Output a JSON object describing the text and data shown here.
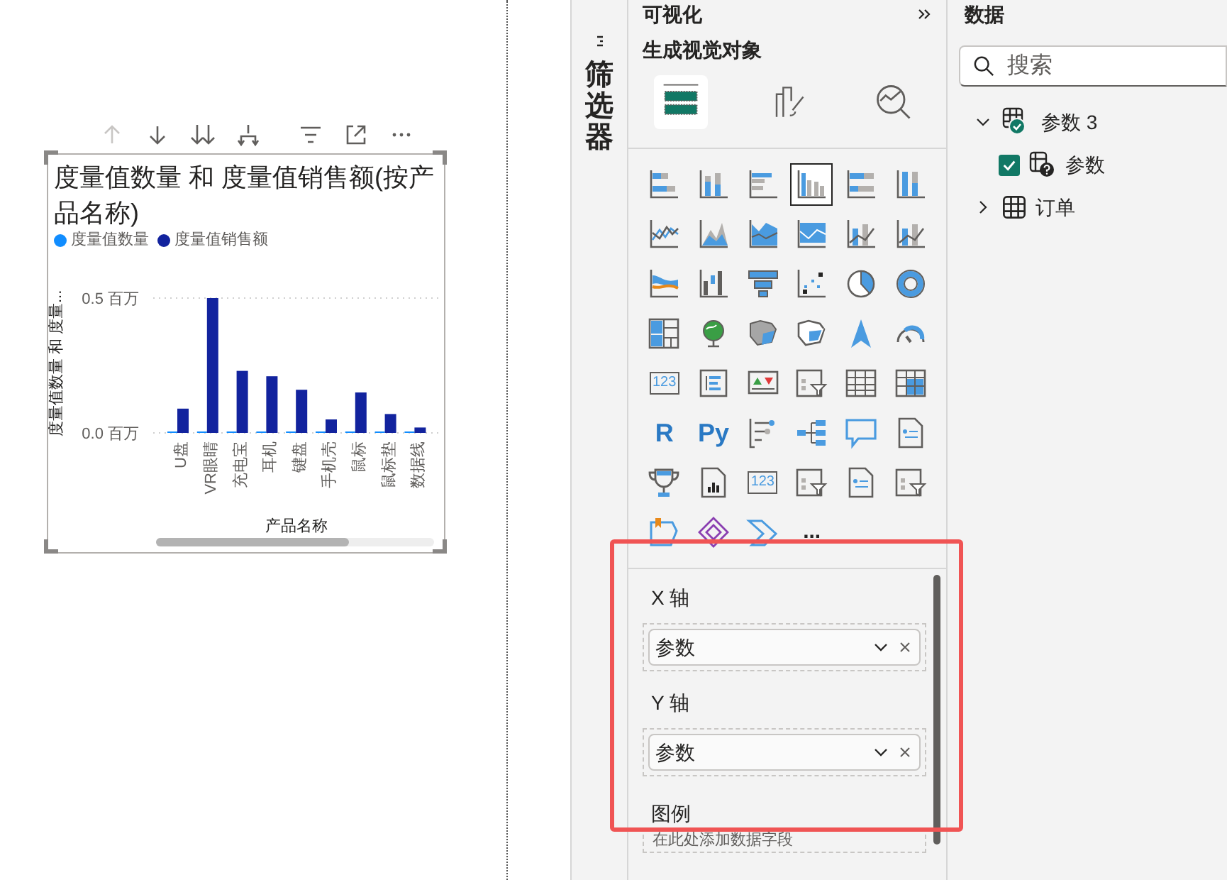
{
  "visual": {
    "title": "度量值数量 和 度量值销售额(按产品名称)",
    "chart_data": {
      "type": "bar",
      "xlabel": "产品名称",
      "ylabel": "度量值数量 和 度量...",
      "categories": [
        "U盘",
        "VR眼睛",
        "充电宝",
        "耳机",
        "键盘",
        "手机壳",
        "鼠标",
        "鼠标垫",
        "数据线"
      ],
      "series": [
        {
          "name": "度量值数量",
          "color": "#118dff",
          "values": [
            0,
            0,
            0,
            0,
            0,
            0,
            0,
            0,
            0
          ]
        },
        {
          "name": "度量值销售额",
          "color": "#12239e",
          "values": [
            0.09,
            0.5,
            0.23,
            0.21,
            0.16,
            0.05,
            0.15,
            0.07,
            0.02
          ]
        }
      ],
      "ylim": [
        0,
        0.5
      ],
      "yticks": [
        {
          "value": 0,
          "label": "0.0 百万"
        },
        {
          "value": 0.5,
          "label": "0.5 百万"
        }
      ]
    }
  },
  "filters_tab": {
    "label": "筛选器"
  },
  "visualizations": {
    "title": "可视化",
    "section": "生成视觉对象",
    "modes": [
      {
        "kind": "build",
        "selected": true
      },
      {
        "kind": "format",
        "selected": false
      },
      {
        "kind": "analytics",
        "selected": false
      }
    ],
    "gallery": [
      {
        "kind": "stacked_bar",
        "selected": false
      },
      {
        "kind": "stacked_column",
        "selected": false
      },
      {
        "kind": "clustered_bar",
        "selected": false
      },
      {
        "kind": "clustered_column",
        "selected": true
      },
      {
        "kind": "full_bar",
        "selected": false
      },
      {
        "kind": "full_column",
        "selected": false
      },
      {
        "kind": "line",
        "selected": false
      },
      {
        "kind": "area",
        "selected": false
      },
      {
        "kind": "stacked_area",
        "selected": false
      },
      {
        "kind": "area_band",
        "selected": false
      },
      {
        "kind": "line_column",
        "selected": false
      },
      {
        "kind": "line_column",
        "selected": false
      },
      {
        "kind": "ribbon",
        "selected": false
      },
      {
        "kind": "waterfall",
        "selected": false
      },
      {
        "kind": "funnel",
        "selected": false
      },
      {
        "kind": "scatter",
        "selected": false
      },
      {
        "kind": "pie",
        "selected": false
      },
      {
        "kind": "donut",
        "selected": false
      },
      {
        "kind": "treemap",
        "selected": false
      },
      {
        "kind": "globe",
        "selected": false
      },
      {
        "kind": "filled_map",
        "selected": false
      },
      {
        "kind": "shape_map",
        "selected": false
      },
      {
        "kind": "arrow",
        "selected": false
      },
      {
        "kind": "gauge",
        "selected": false
      },
      {
        "kind": "card",
        "label": "123",
        "selected": false
      },
      {
        "kind": "list",
        "selected": false
      },
      {
        "kind": "kpi",
        "selected": false
      },
      {
        "kind": "slicer",
        "selected": false
      },
      {
        "kind": "table",
        "selected": false
      },
      {
        "kind": "matrix",
        "selected": false
      },
      {
        "kind": "text",
        "label": "R",
        "selected": false
      },
      {
        "kind": "text",
        "label": "Py",
        "selected": false
      },
      {
        "kind": "influencers",
        "selected": false
      },
      {
        "kind": "tree",
        "selected": false
      },
      {
        "kind": "speech",
        "selected": false
      },
      {
        "kind": "document",
        "selected": false
      },
      {
        "kind": "trophy",
        "selected": false
      },
      {
        "kind": "report",
        "selected": false
      },
      {
        "kind": "card",
        "label": "123",
        "selected": false
      },
      {
        "kind": "slicer",
        "selected": false
      },
      {
        "kind": "document",
        "selected": false
      },
      {
        "kind": "slicer",
        "selected": false
      },
      {
        "kind": "apps",
        "selected": false
      },
      {
        "kind": "diamond",
        "selected": false
      },
      {
        "kind": "automate",
        "selected": false
      },
      {
        "kind": "text",
        "label": "...",
        "selected": false
      }
    ],
    "wells": [
      {
        "label": "X 轴",
        "value": "参数"
      },
      {
        "label": "Y 轴",
        "value": "参数"
      },
      {
        "label": "图例",
        "placeholder": "在此处添加数据字段"
      }
    ]
  },
  "data": {
    "title": "数据",
    "search": {
      "placeholder": "搜索"
    },
    "tree": [
      {
        "label": "参数 3",
        "kind": "parameter",
        "expanded": true,
        "children": [
          {
            "label": "参数",
            "kind": "field",
            "checked": true
          }
        ]
      },
      {
        "label": "订单",
        "kind": "table",
        "expanded": false
      }
    ]
  }
}
